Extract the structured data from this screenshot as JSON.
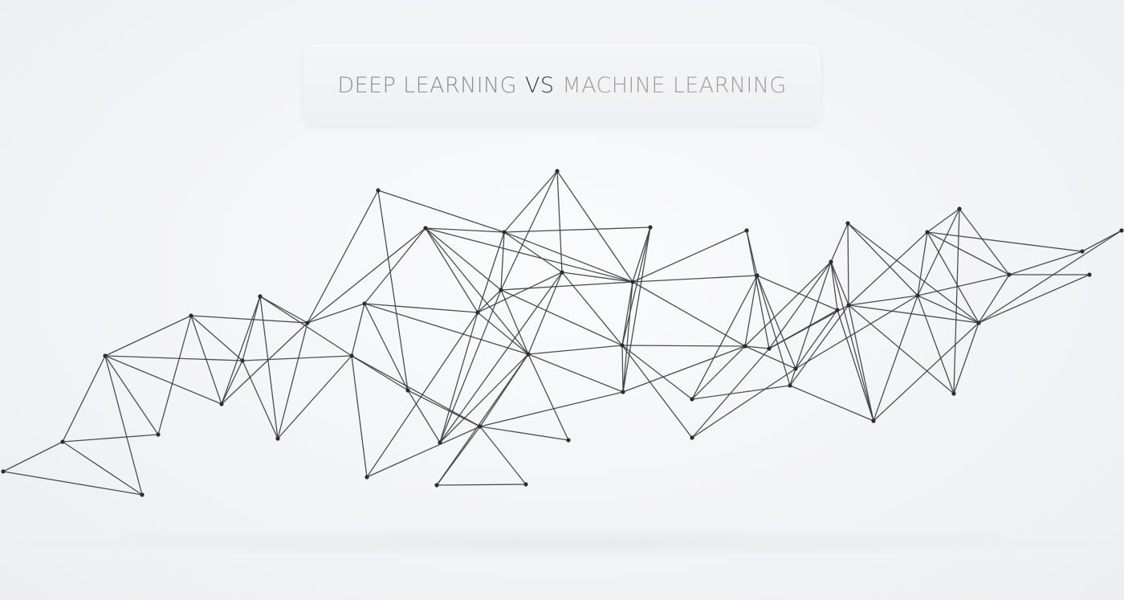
{
  "title": {
    "part_a": "DEEP LEARNING",
    "vs": "VS",
    "part_b": "MACHINE LEARNING"
  },
  "colors": {
    "title_left": "#8e8e92",
    "title_vs": "#3a3a3e",
    "title_right": "#a69a93",
    "line": "#3b3b3f",
    "node": "#2d2d31"
  }
}
